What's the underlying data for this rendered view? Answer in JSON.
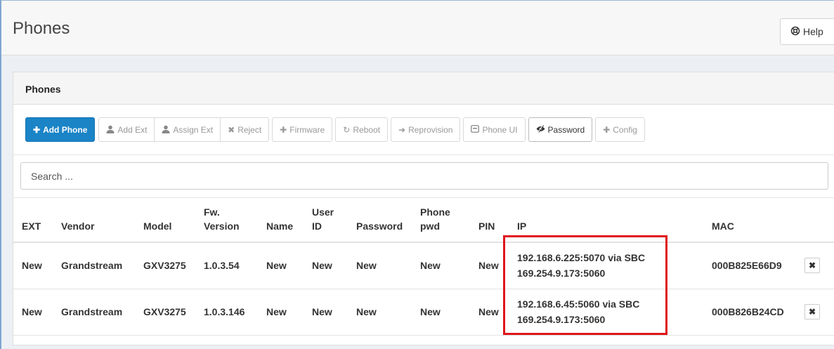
{
  "header": {
    "title": "Phones",
    "help_label": "Help"
  },
  "panel": {
    "title": "Phones"
  },
  "toolbar": {
    "add_phone": "Add Phone",
    "add_ext": "Add Ext",
    "assign_ext": "Assign Ext",
    "reject": "Reject",
    "firmware": "Firmware",
    "reboot": "Reboot",
    "reprovision": "Reprovision",
    "phone_ui": "Phone UI",
    "password": "Password",
    "config": "Config"
  },
  "search": {
    "placeholder": "Search ..."
  },
  "table": {
    "columns": {
      "ext": "EXT",
      "vendor": "Vendor",
      "model": "Model",
      "fw_1": "Fw.",
      "fw_2": "Version",
      "name": "Name",
      "user_1": "User",
      "user_2": "ID",
      "password": "Password",
      "phonepwd_1": "Phone",
      "phonepwd_2": "pwd",
      "pin": "PIN",
      "ip": "IP",
      "mac": "MAC"
    },
    "rows": [
      {
        "ext": "New",
        "vendor": "Grandstream",
        "model": "GXV3275",
        "fw": "1.0.3.54",
        "name": "New",
        "user_id": "New",
        "password": "New",
        "phone_pwd": "New",
        "pin": "New",
        "ip_1": "192.168.6.225:5070 via SBC",
        "ip_2": "169.254.9.173:5060",
        "mac": "000B825E66D9"
      },
      {
        "ext": "New",
        "vendor": "Grandstream",
        "model": "GXV3275",
        "fw": "1.0.3.146",
        "name": "New",
        "user_id": "New",
        "password": "New",
        "phone_pwd": "New",
        "pin": "New",
        "ip_1": "192.168.6.45:5060 via SBC",
        "ip_2": "169.254.9.173:5060",
        "mac": "000B826B24CD"
      }
    ]
  },
  "colors": {
    "primary": "#1a84c7",
    "highlight": "#e0141b"
  }
}
